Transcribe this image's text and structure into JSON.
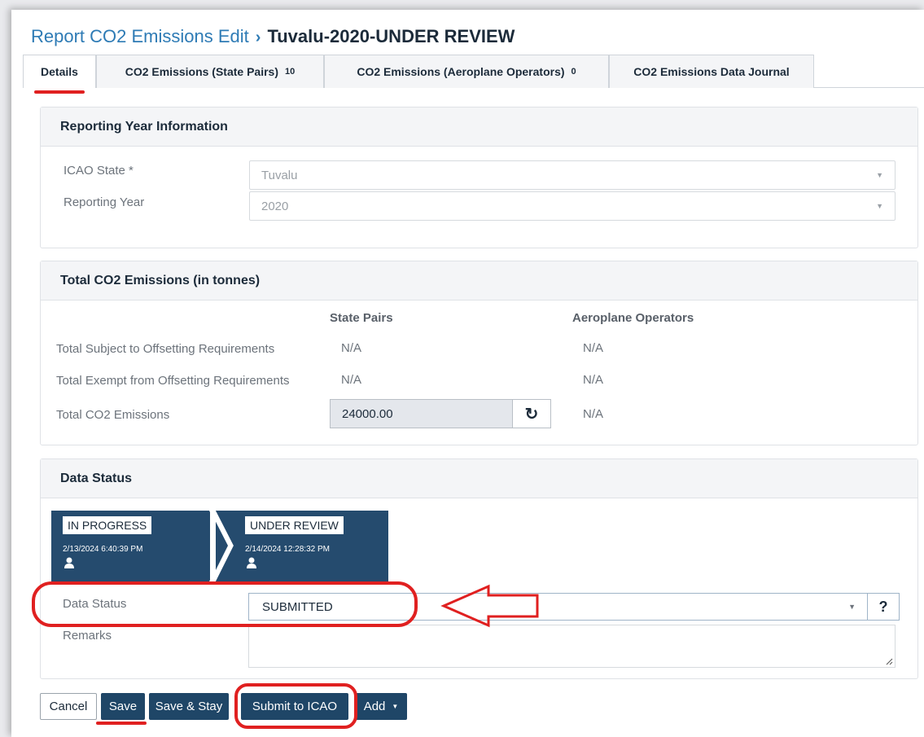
{
  "breadcrumb": {
    "parent": "Report CO2 Emissions Edit",
    "separator": "›",
    "current": "Tuvalu-2020-UNDER REVIEW"
  },
  "tabs": [
    {
      "label": "Details",
      "count": ""
    },
    {
      "label": "CO2 Emissions (State Pairs)",
      "count": "10"
    },
    {
      "label": "CO2 Emissions (Aeroplane Operators)",
      "count": "0"
    },
    {
      "label": "CO2 Emissions Data Journal",
      "count": ""
    }
  ],
  "reporting_year": {
    "title": "Reporting Year Information",
    "state_label": "ICAO State *",
    "state_value": "Tuvalu",
    "year_label": "Reporting Year",
    "year_value": "2020"
  },
  "totals": {
    "title": "Total CO2 Emissions (in tonnes)",
    "col_state_pairs": "State Pairs",
    "col_operators": "Aeroplane Operators",
    "rows": [
      {
        "label": "Total Subject to Offsetting Requirements",
        "state_pairs": "N/A",
        "operators": "N/A"
      },
      {
        "label": "Total Exempt from Offsetting Requirements",
        "state_pairs": "N/A",
        "operators": "N/A"
      },
      {
        "label": "Total CO2 Emissions",
        "state_pairs": "24000.00",
        "operators": "N/A"
      }
    ]
  },
  "data_status": {
    "title": "Data Status",
    "steps": [
      {
        "status": "IN PROGRESS",
        "date": "2/13/2024 6:40:39 PM"
      },
      {
        "status": "UNDER REVIEW",
        "date": "2/14/2024 12:28:32 PM"
      }
    ],
    "status_label": "Data Status",
    "status_value": "SUBMITTED",
    "help": "?",
    "remarks_label": "Remarks"
  },
  "actions": {
    "cancel": "Cancel",
    "save": "Save",
    "save_stay": "Save & Stay",
    "submit": "Submit to ICAO",
    "add": "Add"
  },
  "colors": {
    "primary": "#1f4667",
    "link": "#2e7bb5",
    "annotation": "#e02020"
  }
}
